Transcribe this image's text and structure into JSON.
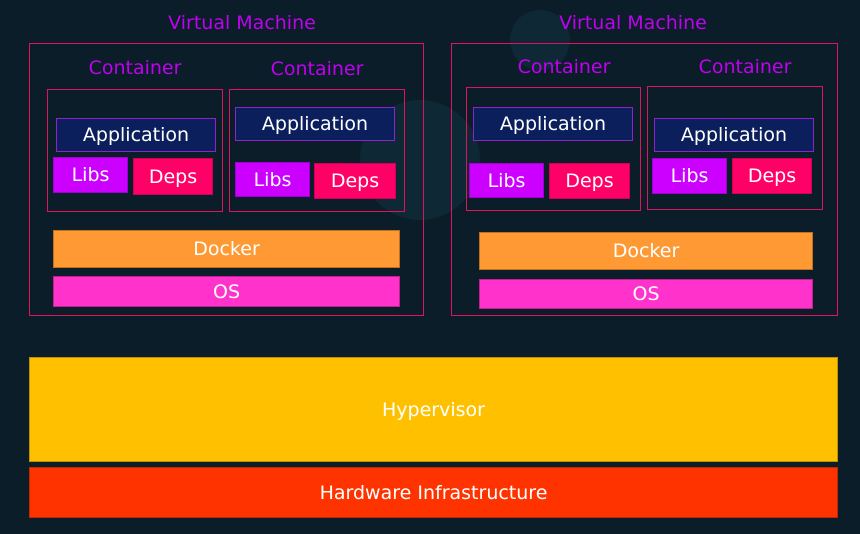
{
  "vms": [
    {
      "title": "Virtual Machine",
      "containers": [
        {
          "title": "Container",
          "app": "Application",
          "libs": "Libs",
          "deps": "Deps"
        },
        {
          "title": "Container",
          "app": "Application",
          "libs": "Libs",
          "deps": "Deps"
        }
      ],
      "docker": "Docker",
      "os": "OS"
    },
    {
      "title": "Virtual Machine",
      "containers": [
        {
          "title": "Container",
          "app": "Application",
          "libs": "Libs",
          "deps": "Deps"
        },
        {
          "title": "Container",
          "app": "Application",
          "libs": "Libs",
          "deps": "Deps"
        }
      ],
      "docker": "Docker",
      "os": "OS"
    }
  ],
  "hypervisor": "Hypervisor",
  "hardware": "Hardware Infrastructure",
  "colors": {
    "background": "#0a1d28",
    "border": "#e0145c",
    "title": "#c000f0",
    "application": "#0b1f5c",
    "libs": "#cc00ff",
    "deps": "#ff0066",
    "docker": "#ff9933",
    "os": "#ff33cc",
    "hypervisor": "#ffc000",
    "hardware": "#ff3300"
  }
}
